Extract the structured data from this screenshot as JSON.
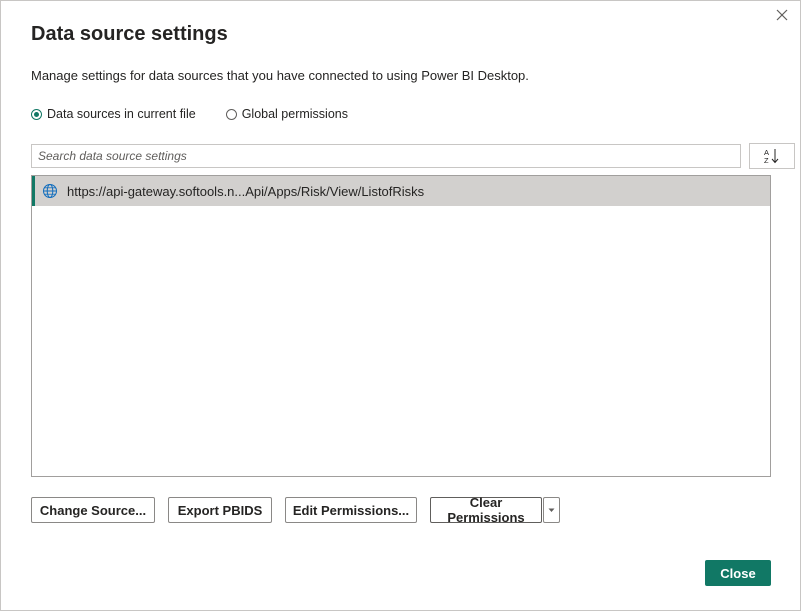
{
  "dialog": {
    "title": "Data source settings",
    "description": "Manage settings for data sources that you have connected to using Power BI Desktop."
  },
  "scope": {
    "options": [
      {
        "label": "Data sources in current file",
        "selected": true
      },
      {
        "label": "Global permissions",
        "selected": false
      }
    ]
  },
  "search": {
    "placeholder": "Search data source settings",
    "value": ""
  },
  "sort": {
    "icon": "sort-a-z-icon"
  },
  "sources": {
    "items": [
      {
        "label": "https://api-gateway.softools.n...Api/Apps/Risk/View/ListofRisks",
        "icon": "globe-icon",
        "selected": true
      }
    ]
  },
  "actions": {
    "change_source": "Change Source...",
    "export_pbids": "Export PBIDS",
    "edit_permissions": "Edit Permissions...",
    "clear_permissions": "Clear Permissions",
    "close": "Close"
  },
  "colors": {
    "accent": "#117865",
    "selected_row": "#d2d0ce"
  }
}
